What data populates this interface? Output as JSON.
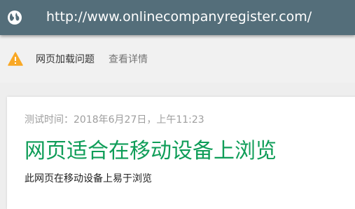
{
  "urlbar": {
    "icon": "globe-icon",
    "url": "http://www.onlinecompanyregister.com/"
  },
  "warning": {
    "icon": "warning-icon",
    "text": "网页加载问题",
    "link": "查看详情",
    "color": "#f9a825"
  },
  "result": {
    "test_time": "测试时间：2018年6月27日，上午11:23",
    "title": "网页适合在移动设备上浏览",
    "subtitle": "此网页在移动设备上易于浏览",
    "title_color": "#0f9d58"
  }
}
